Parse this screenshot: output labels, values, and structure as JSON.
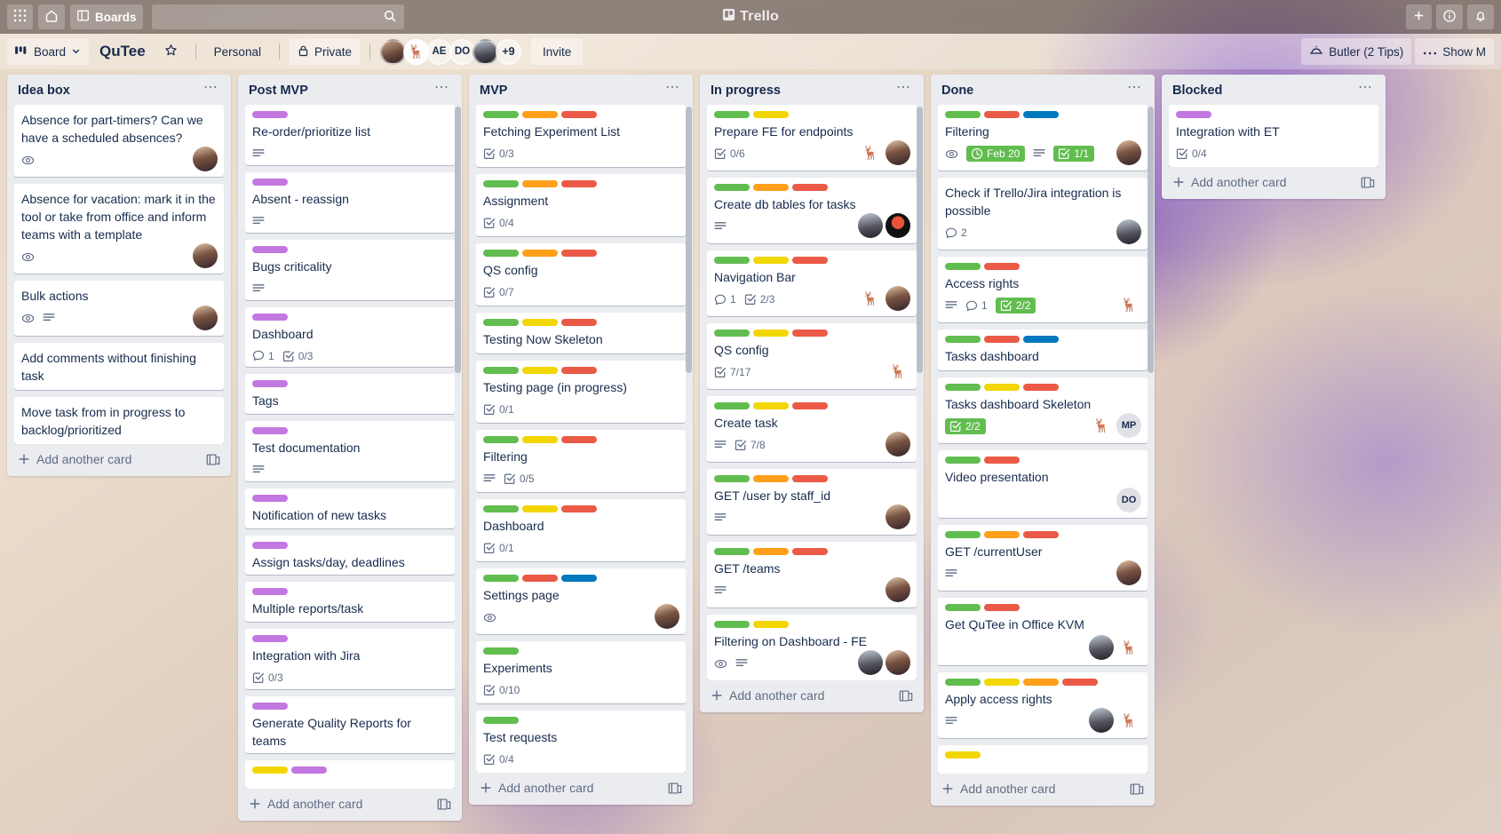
{
  "topnav": {
    "apps_icon": "grid-apps-icon",
    "home_icon": "home-icon",
    "boards_label": "Boards",
    "boards_icon": "board-icon",
    "search_placeholder": "",
    "search_value": "",
    "search_icon": "search-icon",
    "brand": "Trello",
    "brand_icon": "trello-logo-icon",
    "add_icon": "plus-icon",
    "info_icon": "info-icon",
    "notifications_icon": "bell-icon"
  },
  "boardbar": {
    "board_button": "Board",
    "board_icon": "board-view-icon",
    "chevron_icon": "chevron-down-icon",
    "title": "QuTee",
    "star_icon": "star-icon",
    "workspace": "Personal",
    "visibility": "Private",
    "lock_icon": "lock-icon",
    "members": [
      {
        "name": "member-1",
        "initials": "",
        "style": "p-woman"
      },
      {
        "name": "member-2",
        "initials": "🦌",
        "style": "p-deer"
      },
      {
        "name": "member-3",
        "initials": "AE",
        "style": "p-txt"
      },
      {
        "name": "member-4",
        "initials": "DO",
        "style": "p-txt"
      },
      {
        "name": "member-5",
        "initials": "",
        "style": "p-man"
      },
      {
        "name": "member-overflow",
        "initials": "+9",
        "style": "p-txt"
      }
    ],
    "invite_label": "Invite",
    "butler_label": "Butler (2 Tips)",
    "butler_icon": "butler-bell-icon",
    "more_icon": "ellipsis-icon",
    "show_menu_label": "Show M"
  },
  "colors": {
    "label_green": "#61bd4f",
    "label_yellow": "#f2d600",
    "label_orange": "#ff9f1a",
    "label_red": "#eb5a46",
    "label_purple": "#c377e0",
    "label_blue": "#0079bf",
    "badge_done": "#61bd4f",
    "list_bg": "#ebecf0",
    "card_bg": "#ffffff",
    "text": "#172b4d"
  },
  "lists": [
    {
      "title": "Idea box",
      "add_label": "Add another card",
      "has_template_icon": true,
      "scrollbar": false,
      "cards": [
        {
          "title": "Absence for part-timers? Can we have a scheduled absences?",
          "labels": [],
          "badges": [
            {
              "type": "watch"
            }
          ],
          "members": [
            {
              "style": "p-woman",
              "initials": ""
            }
          ]
        },
        {
          "title": "Absence for vacation: mark it in the tool or take from office and inform teams with a template",
          "labels": [],
          "badges": [
            {
              "type": "watch"
            }
          ],
          "members": [
            {
              "style": "p-woman",
              "initials": ""
            }
          ]
        },
        {
          "title": "Bulk actions",
          "labels": [],
          "badges": [
            {
              "type": "watch"
            },
            {
              "type": "description"
            }
          ],
          "members": [
            {
              "style": "p-woman",
              "initials": ""
            }
          ]
        },
        {
          "title": "Add comments without finishing task",
          "labels": [],
          "badges": [],
          "members": []
        },
        {
          "title": "Move task from in progress to backlog/prioritized",
          "labels": [],
          "badges": [],
          "members": []
        }
      ]
    },
    {
      "title": "Post MVP",
      "add_label": "Add another card",
      "has_template_icon": true,
      "scrollbar": true,
      "cards": [
        {
          "title": "Re-order/prioritize list",
          "labels": [
            "purple"
          ],
          "badges": [
            {
              "type": "description"
            }
          ],
          "members": []
        },
        {
          "title": "Absent - reassign",
          "labels": [
            "purple"
          ],
          "badges": [
            {
              "type": "description"
            }
          ],
          "members": []
        },
        {
          "title": "Bugs criticality",
          "labels": [
            "purple"
          ],
          "badges": [
            {
              "type": "description"
            }
          ],
          "members": []
        },
        {
          "title": "Dashboard",
          "labels": [
            "purple"
          ],
          "badges": [
            {
              "type": "comments",
              "text": "1"
            },
            {
              "type": "checklist",
              "text": "0/3"
            }
          ],
          "members": []
        },
        {
          "title": "Tags",
          "labels": [
            "purple"
          ],
          "badges": [],
          "members": []
        },
        {
          "title": "Test documentation",
          "labels": [
            "purple"
          ],
          "badges": [
            {
              "type": "description"
            }
          ],
          "members": []
        },
        {
          "title": "Notification of new tasks",
          "labels": [
            "purple"
          ],
          "badges": [],
          "members": []
        },
        {
          "title": "Assign tasks/day, deadlines",
          "labels": [
            "purple"
          ],
          "badges": [],
          "members": []
        },
        {
          "title": "Multiple reports/task",
          "labels": [
            "purple"
          ],
          "badges": [],
          "members": []
        },
        {
          "title": "Integration with Jira",
          "labels": [
            "purple"
          ],
          "badges": [
            {
              "type": "checklist",
              "text": "0/3"
            }
          ],
          "members": []
        },
        {
          "title": "Generate Quality Reports for teams",
          "labels": [
            "purple"
          ],
          "badges": [],
          "members": []
        },
        {
          "title": "",
          "labels": [
            "yellow",
            "purple"
          ],
          "badges": [],
          "members": []
        }
      ]
    },
    {
      "title": "MVP",
      "add_label": "Add another card",
      "has_template_icon": true,
      "scrollbar": true,
      "cards": [
        {
          "title": "Fetching Experiment List",
          "labels": [
            "green",
            "orange",
            "red"
          ],
          "badges": [
            {
              "type": "checklist",
              "text": "0/3"
            }
          ],
          "members": []
        },
        {
          "title": "Assignment",
          "labels": [
            "green",
            "orange",
            "red"
          ],
          "badges": [
            {
              "type": "checklist",
              "text": "0/4"
            }
          ],
          "members": []
        },
        {
          "title": "QS config",
          "labels": [
            "green",
            "orange",
            "red"
          ],
          "badges": [
            {
              "type": "checklist",
              "text": "0/7"
            }
          ],
          "members": []
        },
        {
          "title": "Testing Now Skeleton",
          "labels": [
            "green",
            "yellow",
            "red"
          ],
          "badges": [],
          "members": []
        },
        {
          "title": "Testing page (in progress)",
          "labels": [
            "green",
            "yellow",
            "red"
          ],
          "badges": [
            {
              "type": "checklist",
              "text": "0/1"
            }
          ],
          "members": []
        },
        {
          "title": "Filtering",
          "labels": [
            "green",
            "yellow",
            "red"
          ],
          "badges": [
            {
              "type": "description"
            },
            {
              "type": "checklist",
              "text": "0/5"
            }
          ],
          "members": []
        },
        {
          "title": "Dashboard",
          "labels": [
            "green",
            "yellow",
            "red"
          ],
          "badges": [
            {
              "type": "checklist",
              "text": "0/1"
            }
          ],
          "members": []
        },
        {
          "title": "Settings page",
          "labels": [
            "green",
            "red",
            "blue"
          ],
          "badges": [
            {
              "type": "watch"
            }
          ],
          "members": [
            {
              "style": "p-woman",
              "initials": ""
            }
          ]
        },
        {
          "title": "Experiments",
          "labels": [
            "green"
          ],
          "badges": [
            {
              "type": "checklist",
              "text": "0/10"
            }
          ],
          "members": []
        },
        {
          "title": "Test requests",
          "labels": [
            "green"
          ],
          "badges": [
            {
              "type": "checklist",
              "text": "0/4"
            }
          ],
          "members": []
        }
      ]
    },
    {
      "title": "In progress",
      "add_label": "Add another card",
      "has_template_icon": true,
      "scrollbar": true,
      "cards": [
        {
          "title": "Prepare FE for endpoints",
          "labels": [
            "green",
            "yellow"
          ],
          "badges": [
            {
              "type": "checklist",
              "text": "0/6"
            }
          ],
          "members": [
            {
              "style": "p-deer",
              "initials": "🦌"
            },
            {
              "style": "p-woman",
              "initials": ""
            }
          ]
        },
        {
          "title": "Create db tables for tasks",
          "labels": [
            "green",
            "orange",
            "red"
          ],
          "badges": [
            {
              "type": "description"
            }
          ],
          "members": [
            {
              "style": "p-man",
              "initials": ""
            },
            {
              "style": "p-red",
              "initials": ""
            }
          ]
        },
        {
          "title": "Navigation Bar",
          "labels": [
            "green",
            "yellow",
            "red"
          ],
          "badges": [
            {
              "type": "comments",
              "text": "1"
            },
            {
              "type": "checklist",
              "text": "2/3"
            }
          ],
          "members": [
            {
              "style": "p-deer",
              "initials": "🦌"
            },
            {
              "style": "p-woman",
              "initials": ""
            }
          ]
        },
        {
          "title": "QS config",
          "labels": [
            "green",
            "yellow",
            "red"
          ],
          "badges": [
            {
              "type": "checklist",
              "text": "7/17"
            }
          ],
          "members": [
            {
              "style": "p-deer",
              "initials": "🦌"
            }
          ]
        },
        {
          "title": "Create task",
          "labels": [
            "green",
            "yellow",
            "red"
          ],
          "badges": [
            {
              "type": "description"
            },
            {
              "type": "checklist",
              "text": "7/8"
            }
          ],
          "members": [
            {
              "style": "p-woman",
              "initials": ""
            }
          ]
        },
        {
          "title": "GET /user by staff_id",
          "labels": [
            "green",
            "orange",
            "red"
          ],
          "badges": [
            {
              "type": "description"
            }
          ],
          "members": [
            {
              "style": "p-woman",
              "initials": ""
            }
          ]
        },
        {
          "title": "GET /teams",
          "labels": [
            "green",
            "orange",
            "red"
          ],
          "badges": [
            {
              "type": "description"
            }
          ],
          "members": [
            {
              "style": "p-woman",
              "initials": ""
            }
          ]
        },
        {
          "title": "Filtering on Dashboard - FE",
          "labels": [
            "green",
            "yellow"
          ],
          "badges": [
            {
              "type": "watch"
            },
            {
              "type": "description"
            }
          ],
          "members": [
            {
              "style": "p-man",
              "initials": ""
            },
            {
              "style": "p-woman",
              "initials": ""
            }
          ]
        }
      ]
    },
    {
      "title": "Done",
      "add_label": "Add another card",
      "has_template_icon": true,
      "scrollbar": true,
      "cards": [
        {
          "title": "Filtering",
          "labels": [
            "green",
            "red",
            "blue"
          ],
          "badges": [
            {
              "type": "watch"
            },
            {
              "type": "due",
              "text": "Feb 20",
              "done": true
            },
            {
              "type": "description"
            },
            {
              "type": "checklist",
              "text": "1/1",
              "done": true
            }
          ],
          "members": [
            {
              "style": "p-woman",
              "initials": ""
            }
          ]
        },
        {
          "title": "Check if Trello/Jira integration is possible",
          "labels": [],
          "badges": [
            {
              "type": "comments",
              "text": "2"
            }
          ],
          "members": [
            {
              "style": "p-man",
              "initials": ""
            }
          ]
        },
        {
          "title": "Access rights",
          "labels": [
            "green",
            "red"
          ],
          "badges": [
            {
              "type": "description"
            },
            {
              "type": "comments",
              "text": "1"
            },
            {
              "type": "checklist",
              "text": "2/2",
              "done": true
            }
          ],
          "members": [
            {
              "style": "p-deer",
              "initials": "🦌"
            }
          ]
        },
        {
          "title": "Tasks dashboard",
          "labels": [
            "green",
            "red",
            "blue"
          ],
          "badges": [],
          "members": []
        },
        {
          "title": "Tasks dashboard Skeleton",
          "labels": [
            "green",
            "yellow",
            "red"
          ],
          "badges": [
            {
              "type": "checklist",
              "text": "2/2",
              "done": true
            }
          ],
          "members": [
            {
              "style": "p-deer",
              "initials": "🦌"
            },
            {
              "style": "p-txt",
              "initials": "MP"
            }
          ]
        },
        {
          "title": "Video presentation",
          "labels": [
            "green",
            "red"
          ],
          "badges": [],
          "members": [
            {
              "style": "p-txt",
              "initials": "DO"
            }
          ]
        },
        {
          "title": "GET /currentUser",
          "labels": [
            "green",
            "orange",
            "red"
          ],
          "badges": [
            {
              "type": "description"
            }
          ],
          "members": [
            {
              "style": "p-woman",
              "initials": ""
            }
          ]
        },
        {
          "title": "Get QuTee in Office KVM",
          "labels": [
            "green",
            "red"
          ],
          "badges": [],
          "members": [
            {
              "style": "p-man",
              "initials": ""
            },
            {
              "style": "p-deer",
              "initials": "🦌"
            }
          ]
        },
        {
          "title": "Apply access rights",
          "labels": [
            "green",
            "yellow",
            "orange",
            "red"
          ],
          "badges": [
            {
              "type": "description"
            }
          ],
          "members": [
            {
              "style": "p-man",
              "initials": ""
            },
            {
              "style": "p-deer",
              "initials": "🦌"
            }
          ]
        },
        {
          "title": "",
          "labels": [
            "yellow"
          ],
          "badges": [],
          "members": []
        }
      ]
    },
    {
      "title": "Blocked",
      "add_label": "Add another card",
      "has_template_icon": true,
      "scrollbar": false,
      "cards": [
        {
          "title": "Integration with ET",
          "labels": [
            "purple"
          ],
          "badges": [
            {
              "type": "checklist",
              "text": "0/4"
            }
          ],
          "members": []
        }
      ]
    }
  ]
}
